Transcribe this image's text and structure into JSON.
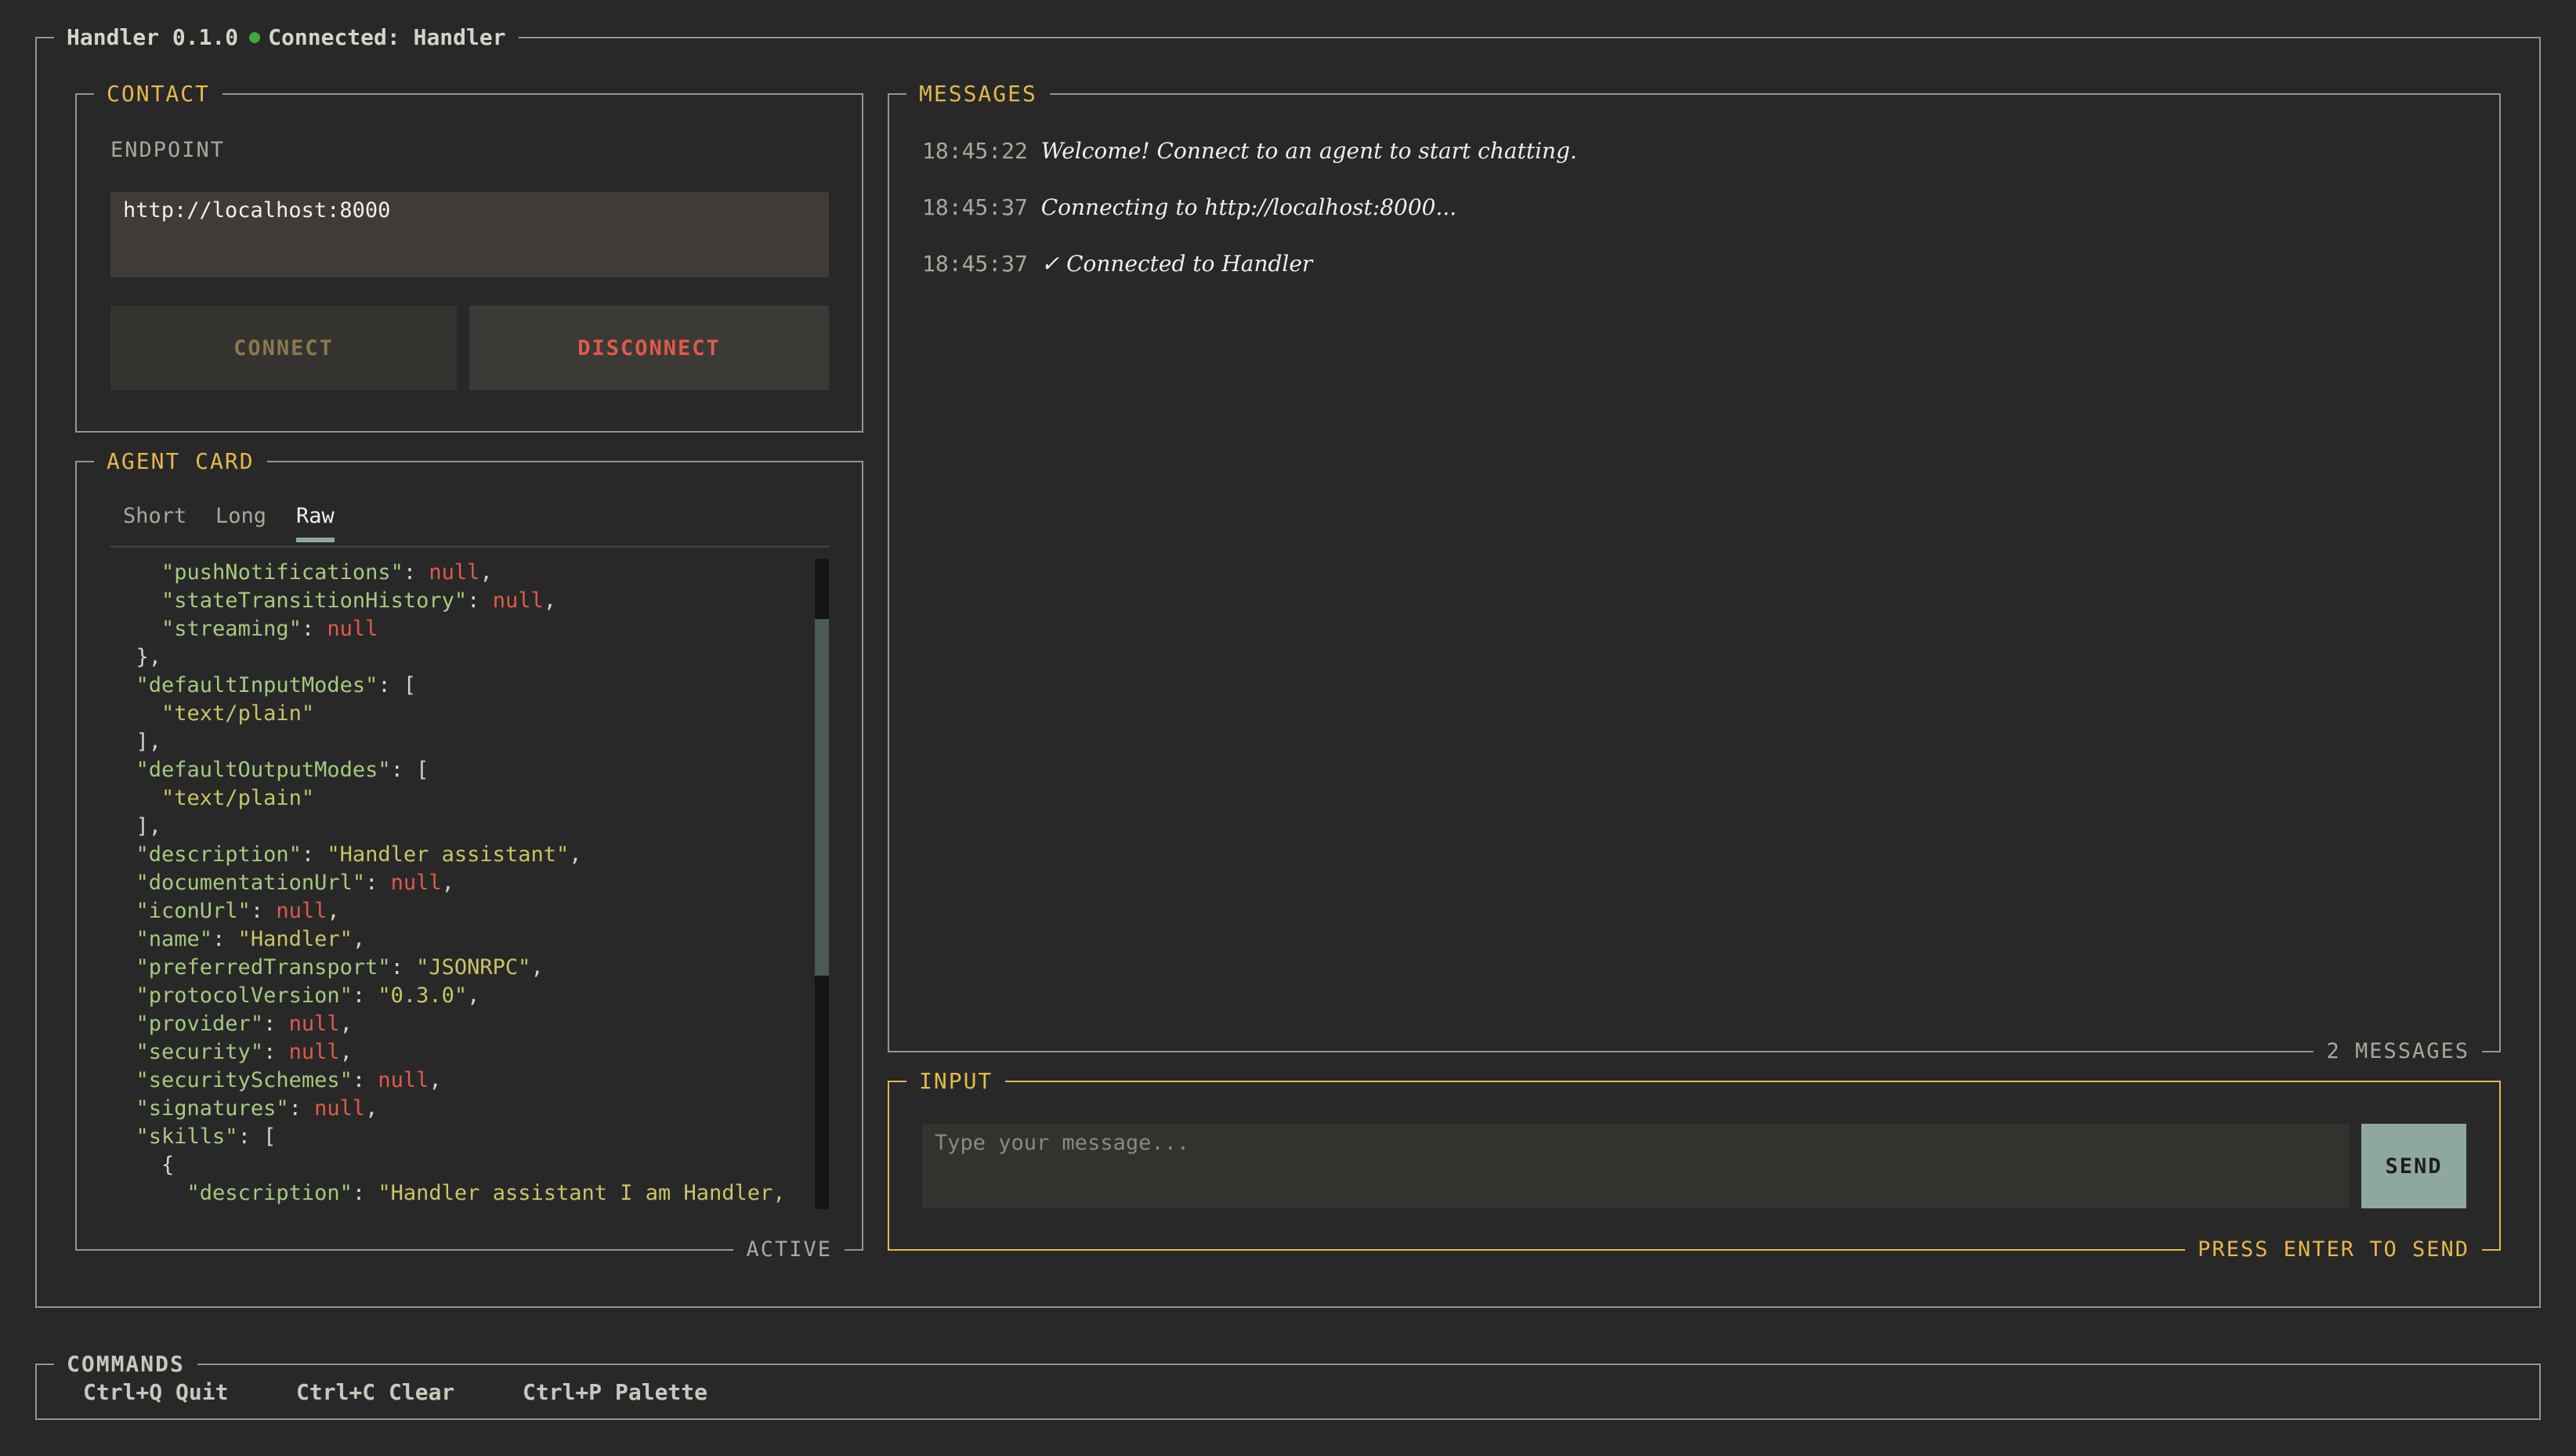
{
  "app": {
    "title": "Handler 0.1.0",
    "status_text": "Connected: Handler",
    "status_color": "#3fa83f"
  },
  "contact": {
    "section_title": "CONTACT",
    "endpoint_label": "ENDPOINT",
    "endpoint_value": "http://localhost:8000",
    "connect_label": "CONNECT",
    "disconnect_label": "DISCONNECT"
  },
  "agent_card": {
    "section_title": "AGENT CARD",
    "tabs": [
      {
        "label": "Short",
        "active": false
      },
      {
        "label": "Long",
        "active": false
      },
      {
        "label": "Raw",
        "active": true
      }
    ],
    "footer": "ACTIVE",
    "raw_lines": [
      [
        [
          "p",
          "    "
        ],
        [
          "k",
          "\"pushNotifications\""
        ],
        [
          "p",
          ": "
        ],
        [
          "n",
          "null"
        ],
        [
          "p",
          ","
        ]
      ],
      [
        [
          "p",
          "    "
        ],
        [
          "k",
          "\"stateTransitionHistory\""
        ],
        [
          "p",
          ": "
        ],
        [
          "n",
          "null"
        ],
        [
          "p",
          ","
        ]
      ],
      [
        [
          "p",
          "    "
        ],
        [
          "k",
          "\"streaming\""
        ],
        [
          "p",
          ": "
        ],
        [
          "n",
          "null"
        ]
      ],
      [
        [
          "p",
          "  },"
        ]
      ],
      [
        [
          "p",
          "  "
        ],
        [
          "k",
          "\"defaultInputModes\""
        ],
        [
          "p",
          ": ["
        ]
      ],
      [
        [
          "p",
          "    "
        ],
        [
          "s",
          "\"text/plain\""
        ]
      ],
      [
        [
          "p",
          "  ],"
        ]
      ],
      [
        [
          "p",
          "  "
        ],
        [
          "k",
          "\"defaultOutputModes\""
        ],
        [
          "p",
          ": ["
        ]
      ],
      [
        [
          "p",
          "    "
        ],
        [
          "s",
          "\"text/plain\""
        ]
      ],
      [
        [
          "p",
          "  ],"
        ]
      ],
      [
        [
          "p",
          "  "
        ],
        [
          "k",
          "\"description\""
        ],
        [
          "p",
          ": "
        ],
        [
          "s",
          "\"Handler assistant\""
        ],
        [
          "p",
          ","
        ]
      ],
      [
        [
          "p",
          "  "
        ],
        [
          "k",
          "\"documentationUrl\""
        ],
        [
          "p",
          ": "
        ],
        [
          "n",
          "null"
        ],
        [
          "p",
          ","
        ]
      ],
      [
        [
          "p",
          "  "
        ],
        [
          "k",
          "\"iconUrl\""
        ],
        [
          "p",
          ": "
        ],
        [
          "n",
          "null"
        ],
        [
          "p",
          ","
        ]
      ],
      [
        [
          "p",
          "  "
        ],
        [
          "k",
          "\"name\""
        ],
        [
          "p",
          ": "
        ],
        [
          "s",
          "\"Handler\""
        ],
        [
          "p",
          ","
        ]
      ],
      [
        [
          "p",
          "  "
        ],
        [
          "k",
          "\"preferredTransport\""
        ],
        [
          "p",
          ": "
        ],
        [
          "s",
          "\"JSONRPC\""
        ],
        [
          "p",
          ","
        ]
      ],
      [
        [
          "p",
          "  "
        ],
        [
          "k",
          "\"protocolVersion\""
        ],
        [
          "p",
          ": "
        ],
        [
          "s",
          "\"0.3.0\""
        ],
        [
          "p",
          ","
        ]
      ],
      [
        [
          "p",
          "  "
        ],
        [
          "k",
          "\"provider\""
        ],
        [
          "p",
          ": "
        ],
        [
          "n",
          "null"
        ],
        [
          "p",
          ","
        ]
      ],
      [
        [
          "p",
          "  "
        ],
        [
          "k",
          "\"security\""
        ],
        [
          "p",
          ": "
        ],
        [
          "n",
          "null"
        ],
        [
          "p",
          ","
        ]
      ],
      [
        [
          "p",
          "  "
        ],
        [
          "k",
          "\"securitySchemes\""
        ],
        [
          "p",
          ": "
        ],
        [
          "n",
          "null"
        ],
        [
          "p",
          ","
        ]
      ],
      [
        [
          "p",
          "  "
        ],
        [
          "k",
          "\"signatures\""
        ],
        [
          "p",
          ": "
        ],
        [
          "n",
          "null"
        ],
        [
          "p",
          ","
        ]
      ],
      [
        [
          "p",
          "  "
        ],
        [
          "k",
          "\"skills\""
        ],
        [
          "p",
          ": ["
        ]
      ],
      [
        [
          "p",
          "    {"
        ]
      ],
      [
        [
          "p",
          "      "
        ],
        [
          "k",
          "\"description\""
        ],
        [
          "p",
          ": "
        ],
        [
          "s",
          "\"Handler assistant I am Handler,"
        ]
      ]
    ]
  },
  "messages": {
    "section_title": "MESSAGES",
    "count_label": "2 MESSAGES",
    "items": [
      {
        "time": "18:45:22",
        "text": "Welcome! Connect to an agent to start chatting."
      },
      {
        "time": "18:45:37",
        "text": "Connecting to http://localhost:8000..."
      },
      {
        "time": "18:45:37",
        "text": "✓ Connected to Handler"
      }
    ]
  },
  "input": {
    "section_title": "INPUT",
    "placeholder": "Type your message...",
    "send_label": "SEND",
    "hint": "PRESS ENTER TO SEND"
  },
  "commands": {
    "section_title": "COMMANDS",
    "items": [
      {
        "label": "Ctrl+Q Quit"
      },
      {
        "label": "Ctrl+C Clear"
      },
      {
        "label": "Ctrl+P Palette"
      }
    ]
  },
  "colors": {
    "accent": "#e6b84a",
    "border": "#8a9a94",
    "background": "#282828",
    "send_button": "#8fa89e",
    "disconnect_text": "#e05a4a",
    "connect_text": "#8a7a4e"
  }
}
